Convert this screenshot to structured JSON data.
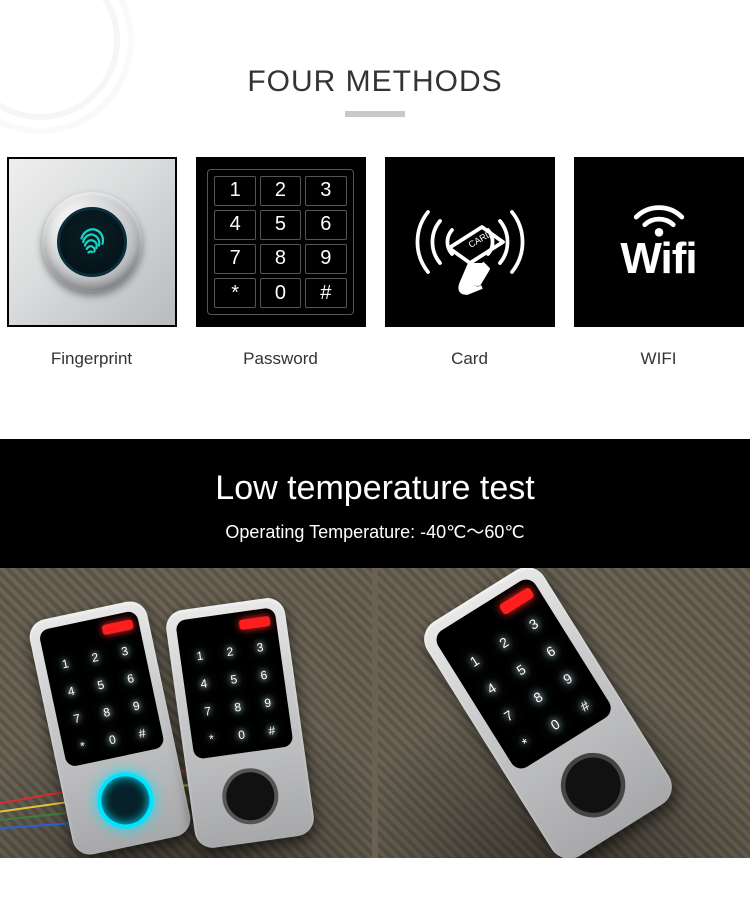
{
  "header": {
    "title": "FOUR METHODS"
  },
  "methods": [
    {
      "label": "Fingerprint"
    },
    {
      "label": "Password"
    },
    {
      "label": "Card"
    },
    {
      "label": "WIFI"
    }
  ],
  "keypad": [
    "1",
    "2",
    "3",
    "4",
    "5",
    "6",
    "7",
    "8",
    "9",
    "*",
    "0",
    "#"
  ],
  "wifi_text": "Wifi",
  "low_temp": {
    "title": "Low temperature test",
    "subtitle": "Operating Temperature: -40℃～60℃"
  },
  "device_keys": [
    "1",
    "2",
    "3",
    "4",
    "5",
    "6",
    "7",
    "8",
    "9",
    "*",
    "0",
    "#"
  ]
}
